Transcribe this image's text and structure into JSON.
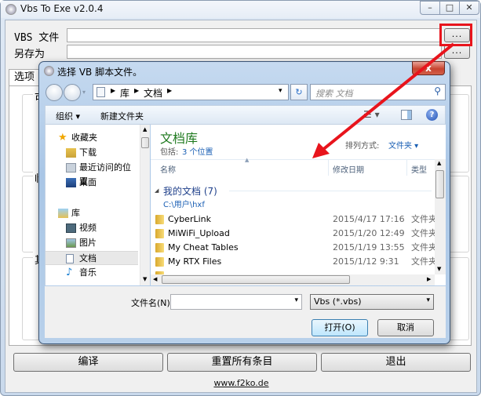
{
  "window": {
    "title": "Vbs To Exe v2.0.4",
    "minimize": "–",
    "maximize": "□",
    "close": "✕"
  },
  "form": {
    "vbs_file_label": "VBS 文件",
    "vbs_file_value": "",
    "save_as_label": "另存为",
    "save_as_value": "",
    "browse_label": "...",
    "tab_options": "选项",
    "group_visibility": "可见",
    "group_temp": "临时",
    "group_other": "其它"
  },
  "buttons": {
    "compile": "编译",
    "reset_all": "重置所有条目",
    "exit": "退出"
  },
  "footer": {
    "link": "www.f2ko.de"
  },
  "dialog": {
    "title": "选择 VB 脚本文件。",
    "close": "x",
    "breadcrumb": [
      "库",
      "文档"
    ],
    "search_placeholder": "搜索 文档",
    "toolbar": {
      "organize": "组织 ▾",
      "new_folder": "新建文件夹"
    },
    "nav": {
      "favorites": "收藏夹",
      "favorites_items": [
        "下载",
        "最近访问的位置",
        "桌面"
      ],
      "libraries": "库",
      "libraries_items": [
        "视频",
        "图片",
        "文档",
        "音乐"
      ],
      "selected": "文档"
    },
    "library": {
      "title": "文档库",
      "includes_label": "包括:",
      "includes_link": "3 个位置",
      "arrange_label": "排列方式:",
      "arrange_value": "文件夹 ▾"
    },
    "columns": [
      "名称",
      "修改日期",
      "类型"
    ],
    "group": {
      "name": "我的文档 (7)",
      "path": "C:\\用户\\hxf"
    },
    "files": [
      {
        "name": "CyberLink",
        "date": "2015/4/17 17:16",
        "type": "文件夹"
      },
      {
        "name": "MiWiFi_Upload",
        "date": "2015/1/20 12:49",
        "type": "文件夹"
      },
      {
        "name": "My Cheat Tables",
        "date": "2015/1/19 13:55",
        "type": "文件夹"
      },
      {
        "name": "My RTX Files",
        "date": "2015/1/12 9:31",
        "type": "文件夹"
      }
    ],
    "filename_label": "文件名(N):",
    "filename_value": "",
    "filter_value": "Vbs (*.vbs)",
    "open": "打开(O)",
    "cancel": "取消"
  },
  "annotation": {
    "color": "#e8141c"
  }
}
